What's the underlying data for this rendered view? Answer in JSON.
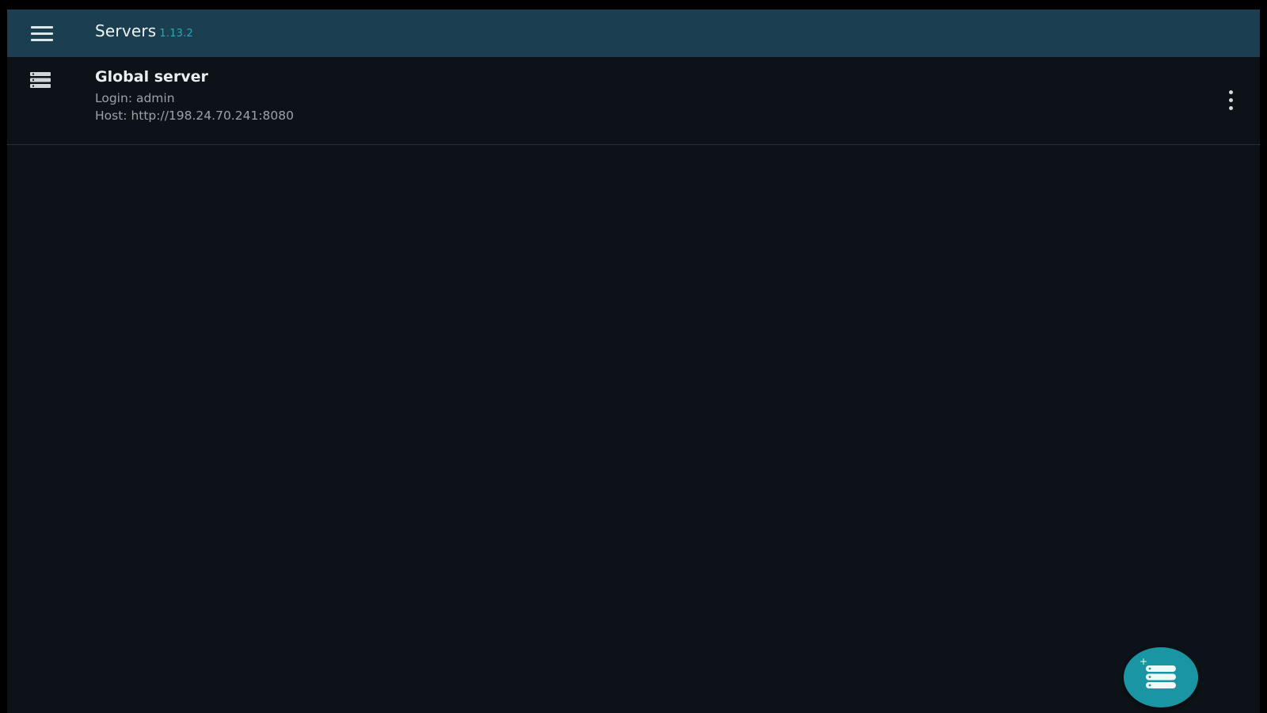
{
  "appbar": {
    "title": "Servers",
    "version": "1.13.2",
    "background": "#1b3f51",
    "version_color": "#2aa8b3",
    "menu_icon": "hamburger-menu-icon"
  },
  "servers": [
    {
      "name": "Global server",
      "login_line": "Login: admin",
      "host_line": "Host: http://198.24.70.241:8080",
      "icon": "server-stack-icon",
      "menu_icon": "more-vertical-icon"
    }
  ],
  "fab": {
    "icon": "add-server-icon",
    "color": "#1a95a3"
  },
  "colors": {
    "background": "#0c1217",
    "divider": "#263037"
  }
}
